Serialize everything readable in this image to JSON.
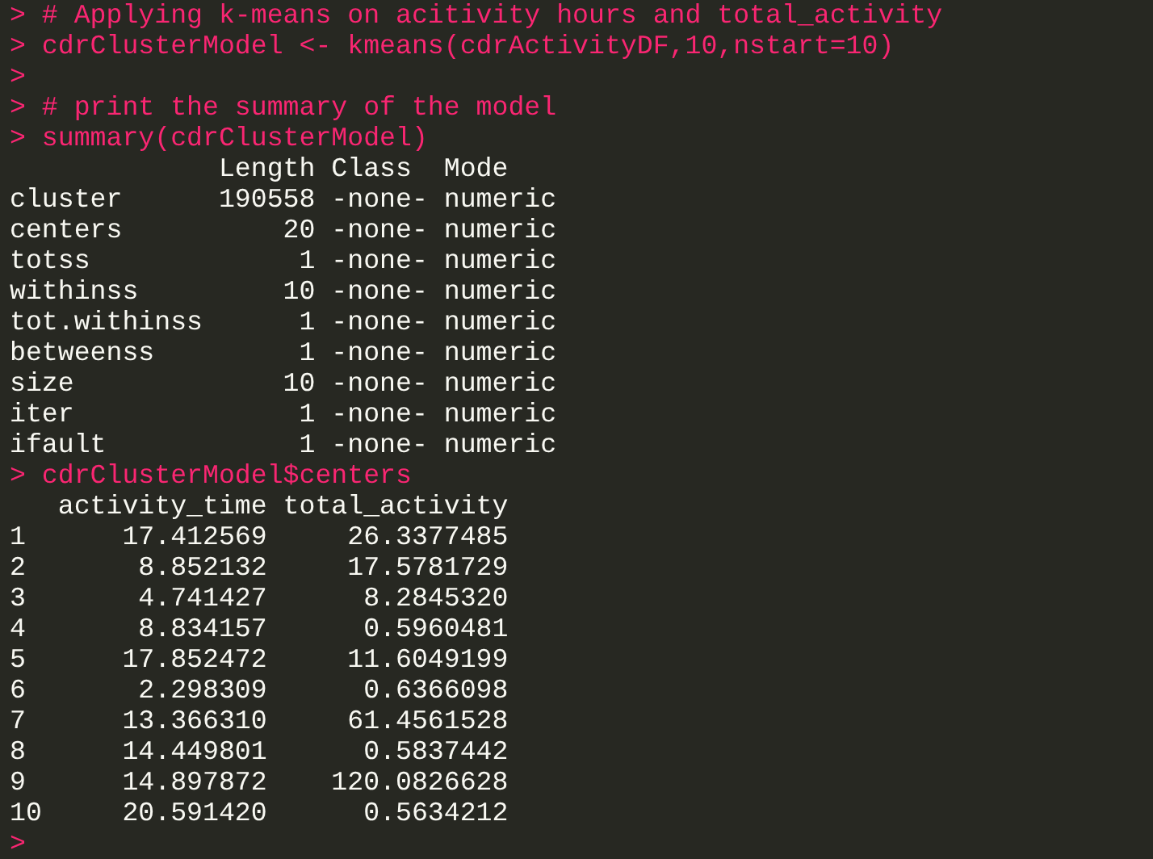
{
  "console": {
    "lines": [
      {
        "kind": "input",
        "text": "> # Applying k-means on acitivity hours and total_activity"
      },
      {
        "kind": "input",
        "text": "> cdrClusterModel <- kmeans(cdrActivityDF,10,nstart=10)"
      },
      {
        "kind": "input",
        "text": ">"
      },
      {
        "kind": "input",
        "text": "> # print the summary of the model"
      },
      {
        "kind": "input",
        "text": "> summary(cdrClusterModel)"
      },
      {
        "kind": "output",
        "text": "             Length Class  Mode"
      },
      {
        "kind": "output",
        "text": "cluster      190558 -none- numeric"
      },
      {
        "kind": "output",
        "text": "centers          20 -none- numeric"
      },
      {
        "kind": "output",
        "text": "totss             1 -none- numeric"
      },
      {
        "kind": "output",
        "text": "withinss         10 -none- numeric"
      },
      {
        "kind": "output",
        "text": "tot.withinss      1 -none- numeric"
      },
      {
        "kind": "output",
        "text": "betweenss         1 -none- numeric"
      },
      {
        "kind": "output",
        "text": "size             10 -none- numeric"
      },
      {
        "kind": "output",
        "text": "iter              1 -none- numeric"
      },
      {
        "kind": "output",
        "text": "ifault            1 -none- numeric"
      },
      {
        "kind": "input",
        "text": "> cdrClusterModel$centers"
      },
      {
        "kind": "output",
        "text": "   activity_time total_activity"
      },
      {
        "kind": "output",
        "text": "1      17.412569     26.3377485"
      },
      {
        "kind": "output",
        "text": "2       8.852132     17.5781729"
      },
      {
        "kind": "output",
        "text": "3       4.741427      8.2845320"
      },
      {
        "kind": "output",
        "text": "4       8.834157      0.5960481"
      },
      {
        "kind": "output",
        "text": "5      17.852472     11.6049199"
      },
      {
        "kind": "output",
        "text": "6       2.298309      0.6366098"
      },
      {
        "kind": "output",
        "text": "7      13.366310     61.4561528"
      },
      {
        "kind": "output",
        "text": "8      14.449801      0.5837442"
      },
      {
        "kind": "output",
        "text": "9      14.897872    120.0826628"
      },
      {
        "kind": "output",
        "text": "10     20.591420      0.5634212"
      },
      {
        "kind": "input",
        "text": ">"
      }
    ]
  }
}
